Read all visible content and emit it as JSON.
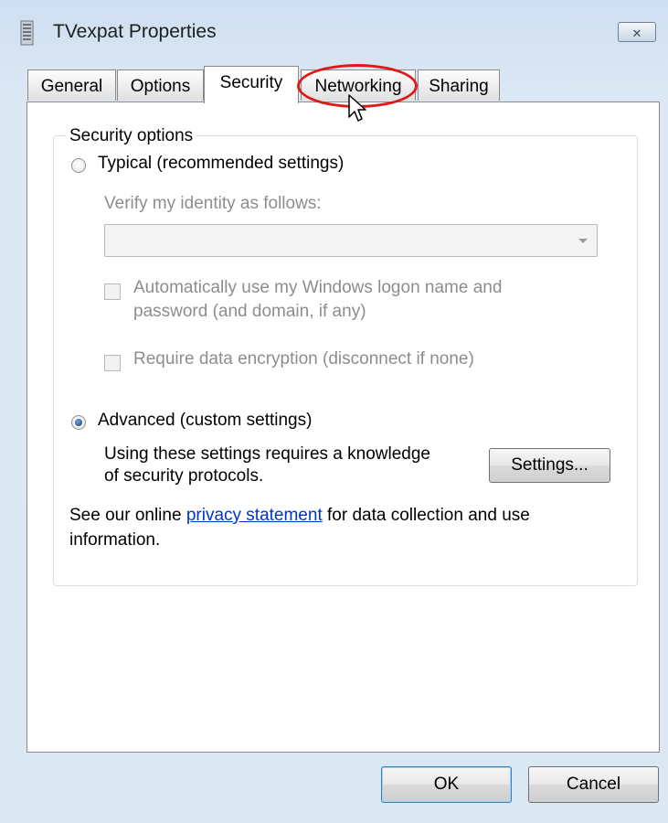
{
  "window": {
    "title": "TVexpat Properties",
    "close_glyph": "✕"
  },
  "tabs": [
    {
      "label": "General"
    },
    {
      "label": "Options"
    },
    {
      "label": "Security"
    },
    {
      "label": "Networking"
    },
    {
      "label": "Sharing"
    }
  ],
  "active_tab": "Security",
  "security": {
    "group_title": "Security options",
    "typical_label": "Typical (recommended settings)",
    "typical_selected": false,
    "verify_label": "Verify my identity as follows:",
    "verify_value": "",
    "auto_logon_line1": "Automatically use my Windows logon name and",
    "auto_logon_line2": "password (and domain, if any)",
    "require_encryption_label": "Require data encryption (disconnect if none)",
    "advanced_label": "Advanced (custom settings)",
    "advanced_selected": true,
    "advanced_desc_line1": "Using these settings requires a knowledge",
    "advanced_desc_line2": "of security protocols.",
    "settings_button": "Settings...",
    "privacy_prefix": "See our online ",
    "privacy_link": "privacy statement",
    "privacy_suffix": " for data collection and use",
    "privacy_line2": "information."
  },
  "buttons": {
    "ok": "OK",
    "cancel": "Cancel"
  },
  "colors": {
    "highlight": "#e01818",
    "link": "#0033cc",
    "accent": "#1c4f8e"
  },
  "icons": [
    "app-icon",
    "close-icon",
    "mouse-cursor-icon"
  ]
}
